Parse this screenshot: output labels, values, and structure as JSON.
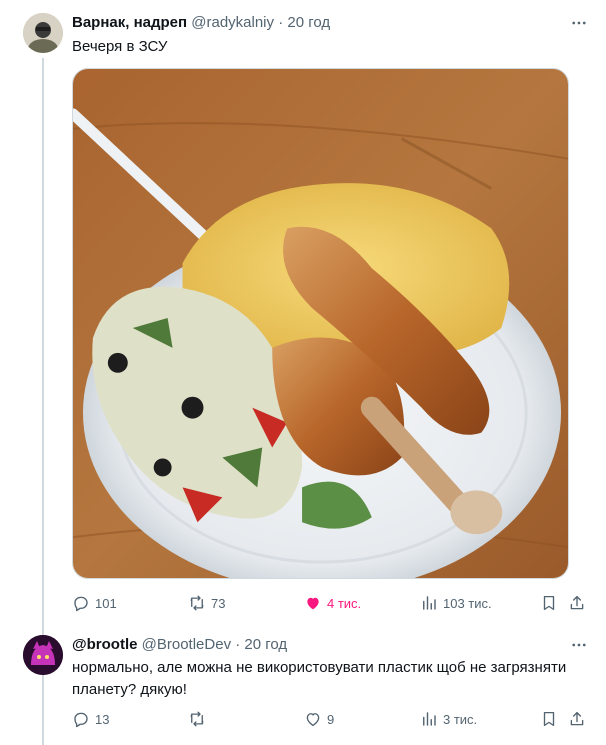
{
  "tweet1": {
    "name": "Варнак, надреп",
    "handle": "@radykalniy",
    "dot": "·",
    "time": "20 год",
    "text": "Вечеря в ЗСУ",
    "replies": "101",
    "retweets": "73",
    "likes": "4 тис.",
    "views": "103 тис.",
    "liked": true
  },
  "tweet2": {
    "name": "@brootle",
    "handle": "@BrootleDev",
    "dot": "·",
    "time": "20 год",
    "text_line1": "нормально, але можна не використовувати пластик щоб не загрязняти",
    "text_line2": "планету? дякую!",
    "replies": "13",
    "retweets": "",
    "likes": "9",
    "views": "3 тис."
  },
  "colors": {
    "secondary_text": "#536471",
    "like_pink": "#f91880",
    "thread_line": "#cfd9de"
  },
  "icons": [
    "more-icon",
    "reply-icon",
    "retweet-icon",
    "like-icon",
    "views-icon",
    "bookmark-icon",
    "share-icon"
  ]
}
